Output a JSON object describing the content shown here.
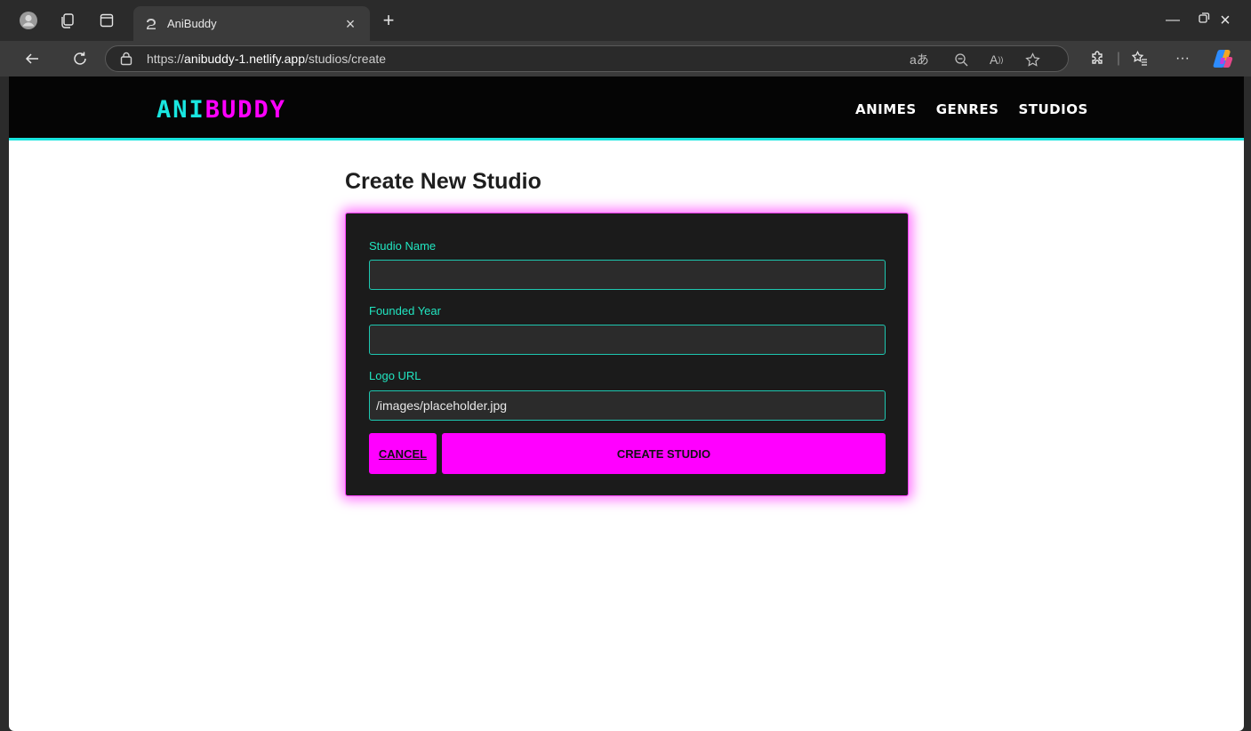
{
  "browser": {
    "tab_title": "AniBuddy",
    "url_scheme": "https://",
    "url_host": "anibuddy-1.netlify.app",
    "url_path": "/studios/create"
  },
  "site": {
    "logo_part1": "ANI",
    "logo_part2": "BUDDY",
    "nav": [
      {
        "label": "ANIMES"
      },
      {
        "label": "GENRES"
      },
      {
        "label": "STUDIOS"
      }
    ]
  },
  "page": {
    "title": "Create New Studio"
  },
  "form": {
    "studio_name": {
      "label": "Studio Name",
      "value": ""
    },
    "founded_year": {
      "label": "Founded Year",
      "value": ""
    },
    "logo_url": {
      "label": "Logo URL",
      "value": "/images/placeholder.jpg"
    },
    "cancel_label": "CANCEL",
    "submit_label": "CREATE STUDIO"
  },
  "colors": {
    "accent_cyan": "#19e6e0",
    "accent_magenta": "#ff00ff",
    "card_bg": "#1b1b1b"
  }
}
